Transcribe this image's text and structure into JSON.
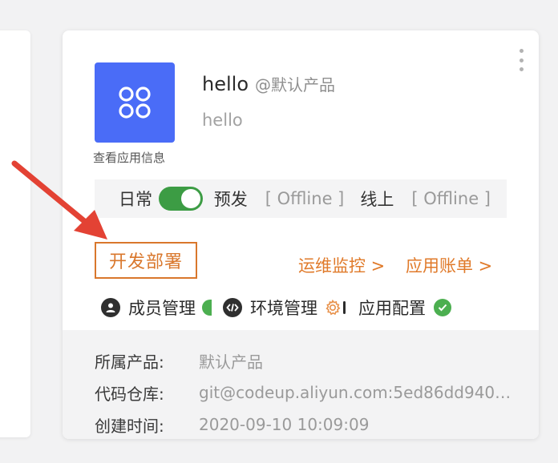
{
  "card": {
    "app_name": "hello",
    "app_product": "@默认产品",
    "app_desc": "hello",
    "view_info": "查看应用信息",
    "env": [
      {
        "label": "日常",
        "status": ""
      },
      {
        "label": "预发",
        "status": "[ Offline ]"
      },
      {
        "label": "线上",
        "status": "[ Offline ]"
      }
    ],
    "deploy_label": "开发部署",
    "monitor_link": "运维监控 >",
    "billing_link": "应用账单 >",
    "manage": {
      "members": "成员管理",
      "env_manage": "环境管理",
      "app_config": "应用配置"
    },
    "info": [
      {
        "key": "所属产品:",
        "value": "默认产品"
      },
      {
        "key": "代码仓库:",
        "value": "git@codeup.aliyun.com:5ed86dd940…"
      },
      {
        "key": "创建时间:",
        "value": "2020-09-10 10:09:09"
      }
    ]
  },
  "colors": {
    "accent": "#d9772c",
    "app_icon": "#4a6cf7",
    "toggle_on": "#3c9c44",
    "arrow": "#e34234"
  },
  "icons": [
    "app-logo-icon",
    "more-vertical-icon",
    "user-icon",
    "code-icon",
    "gear-icon",
    "check-icon",
    "arrow-annotation-icon"
  ]
}
